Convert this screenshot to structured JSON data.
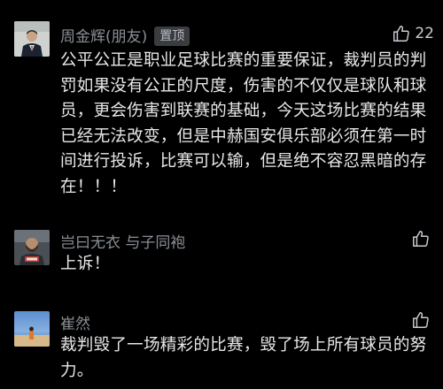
{
  "comments": [
    {
      "name": "周金辉(朋友)",
      "badge": "置顶",
      "likes": "22",
      "text": "公平公正是职业足球比赛的重要保证，裁判员的判罚如果没有公正的尺度，伤害的不仅仅是球队和球员，更会伤害到联赛的基础，今天这场比赛的结果已经无法改变，但是中赫国安俱乐部必须在第一时间进行投诉，比赛可以输，但是绝不容忍黑暗的存在！！！"
    },
    {
      "name": "岂曰无衣 与子同袍",
      "likes": "",
      "text": "上诉！"
    },
    {
      "name": "崔然",
      "likes": "",
      "text": "裁判毁了一场精彩的比赛，毁了场上所有球员的努力。"
    }
  ],
  "icons": {
    "like": "thumbs-up-icon"
  }
}
